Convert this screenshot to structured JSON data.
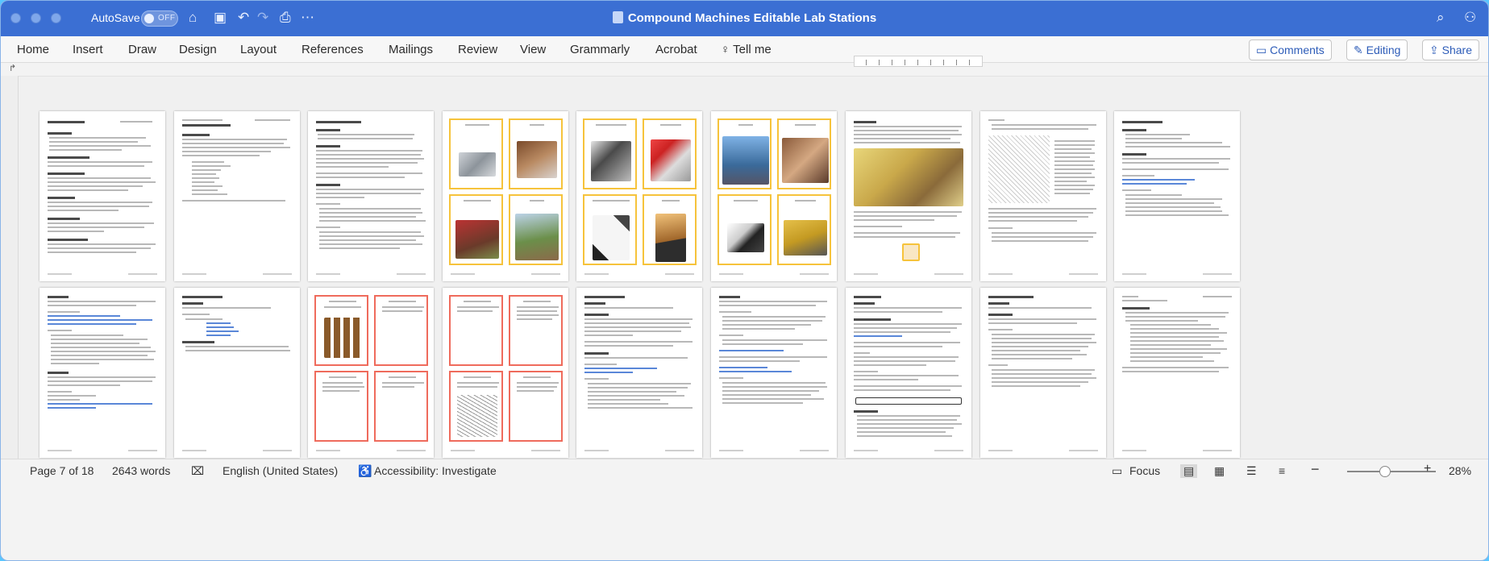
{
  "titlebar": {
    "autosave_label": "AutoSave",
    "autosave_state": "OFF",
    "document_title": "Compound Machines Editable Lab Stations"
  },
  "ribbon": {
    "tabs": [
      "Home",
      "Insert",
      "Draw",
      "Design",
      "Layout",
      "References",
      "Mailings",
      "Review",
      "View",
      "Grammarly",
      "Acrobat"
    ],
    "tell_me": "Tell me",
    "comments_label": "Comments",
    "editing_label": "Editing",
    "share_label": "Share"
  },
  "status": {
    "page": "Page 7 of 18",
    "words": "2643 words",
    "language": "English (United States)",
    "accessibility": "Accessibility: Investigate",
    "focus_label": "Focus",
    "zoom": "28%",
    "zoom_level": 0.28
  },
  "colors": {
    "titlebar": "#3b6fd3",
    "card_yellow": "#f6c33b",
    "card_red": "#ef6b5c",
    "link_blue": "#5a87d8"
  },
  "icons": {
    "home": "home-icon",
    "save": "save-icon",
    "undo": "undo-icon",
    "redo": "redo-icon",
    "print": "print-icon",
    "more": "more-icon",
    "search": "search-icon",
    "share_profile": "people-icon",
    "lightbulb": "lightbulb-icon"
  }
}
